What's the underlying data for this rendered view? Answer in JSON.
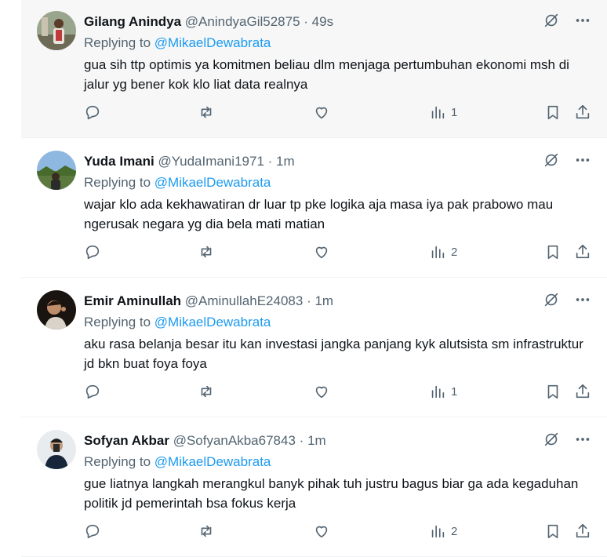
{
  "tweets": [
    {
      "name": "Gilang Anindya",
      "handle": "@AnindyaGil52875",
      "separator": "·",
      "time": "49s",
      "replying_prefix": "Replying to ",
      "replying_to": "@MikaelDewabrata",
      "text": "gua sih ttp optimis ya komitmen beliau dlm menjaga pertumbuhan ekonomi msh di jalur yg bener kok klo liat data realnya",
      "views": "1",
      "highlighted": true
    },
    {
      "name": "Yuda Imani",
      "handle": "@YudaImani1971",
      "separator": "·",
      "time": "1m",
      "replying_prefix": "Replying to ",
      "replying_to": "@MikaelDewabrata",
      "text": "wajar klo ada kekhawatiran dr luar tp pke logika aja masa iya pak prabowo mau ngerusak negara yg dia bela mati matian",
      "views": "2",
      "highlighted": false
    },
    {
      "name": "Emir Aminullah",
      "handle": "@AminullahE24083",
      "separator": "·",
      "time": "1m",
      "replying_prefix": "Replying to ",
      "replying_to": "@MikaelDewabrata",
      "text": "aku rasa belanja besar itu kan investasi jangka panjang kyk alutsista sm infrastruktur jd bkn buat foya foya",
      "views": "1",
      "highlighted": false
    },
    {
      "name": "Sofyan Akbar",
      "handle": "@SofyanAkba67843",
      "separator": "·",
      "time": "1m",
      "replying_prefix": "Replying to ",
      "replying_to": "@MikaelDewabrata",
      "text": "gue liatnya langkah merangkul banyk pihak tuh justru bagus biar ga ada kegaduhan politik jd pemerintah bsa fokus kerja",
      "views": "2",
      "highlighted": false
    }
  ],
  "icons": {
    "grok": "grok-icon",
    "more": "more-icon",
    "reply": "reply-icon",
    "retweet": "retweet-icon",
    "like": "like-icon",
    "views": "views-icon",
    "bookmark": "bookmark-icon",
    "share": "share-icon"
  },
  "colors": {
    "accent": "#1d9bf0",
    "muted": "#536471",
    "highlight_bg": "#f7f7f7"
  }
}
